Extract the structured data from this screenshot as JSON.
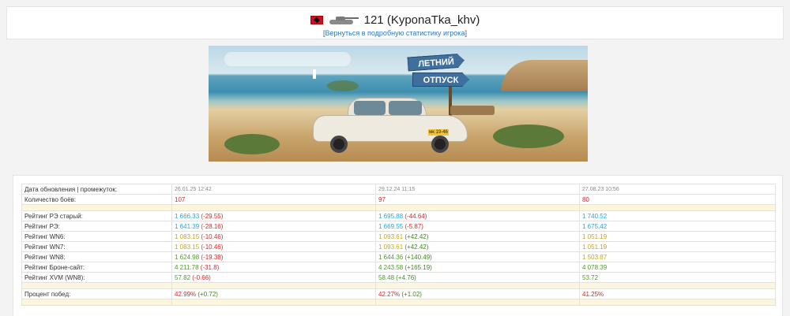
{
  "header": {
    "title": "121 (KyponaTka_khv)",
    "back_link": "Вернуться в подробную статистику игрока",
    "bracket_open": "[",
    "bracket_close": "]"
  },
  "banner": {
    "sign_line1": "ЛЕТНИЙ",
    "sign_line2": "ОТПУСК",
    "plate": "мк 19-46"
  },
  "table": {
    "header_label": "Дата обновления | промежуток:",
    "dates": [
      "26.01.25 12:42",
      "29.12.24 11:15",
      "27.08.23 10:56"
    ],
    "battles": {
      "label": "Количество боёв:",
      "values": [
        "107",
        "97",
        "80"
      ]
    },
    "rows": [
      {
        "label": "Рейтинг РЭ старый:",
        "color": "blue",
        "values": [
          {
            "v": "1 666.33",
            "d": "(-29.55)",
            "dc": "neg"
          },
          {
            "v": "1 695.88",
            "d": "(-44.64)",
            "dc": "neg"
          },
          {
            "v": "1 740.52",
            "d": "",
            "dc": ""
          }
        ]
      },
      {
        "label": "Рейтинг РЭ:",
        "color": "blue",
        "values": [
          {
            "v": "1 641.39",
            "d": "(-28.16)",
            "dc": "neg"
          },
          {
            "v": "1 669.55",
            "d": "(-5.87)",
            "dc": "neg"
          },
          {
            "v": "1 675.42",
            "d": "",
            "dc": ""
          }
        ]
      },
      {
        "label": "Рейтинг WN6:",
        "color": "yellow",
        "values": [
          {
            "v": "1 083.15",
            "d": "(-10.46)",
            "dc": "neg"
          },
          {
            "v": "1 093.61",
            "d": "(+42.42)",
            "dc": "pos"
          },
          {
            "v": "1 051.19",
            "d": "",
            "dc": ""
          }
        ]
      },
      {
        "label": "Рейтинг WN7:",
        "color": "yellow",
        "values": [
          {
            "v": "1 083.15",
            "d": "(-10.46)",
            "dc": "neg"
          },
          {
            "v": "1 093.61",
            "d": "(+42.42)",
            "dc": "pos"
          },
          {
            "v": "1 051.19",
            "d": "",
            "dc": ""
          }
        ]
      },
      {
        "label": "Рейтинг WN8:",
        "color": "green",
        "values": [
          {
            "v": "1 624.98",
            "d": "(-19.38)",
            "dc": "neg"
          },
          {
            "v": "1 644.36",
            "d": "(+140.49)",
            "dc": "pos"
          },
          {
            "v": "1 503.87",
            "d": "",
            "dc": "",
            "color": "yellow"
          }
        ]
      },
      {
        "label": "Рейтинг Броне-сайт:",
        "color": "green",
        "values": [
          {
            "v": "4 211.78",
            "d": "(-31.8)",
            "dc": "neg"
          },
          {
            "v": "4 243.58",
            "d": "(+165.19)",
            "dc": "pos"
          },
          {
            "v": "4 078.39",
            "d": "",
            "dc": ""
          }
        ]
      },
      {
        "label": "Рейтинг XVM (WN8):",
        "color": "green",
        "values": [
          {
            "v": "57.82",
            "d": "(-0.66)",
            "dc": "neg"
          },
          {
            "v": "58.48",
            "d": "(+4.76)",
            "dc": "pos"
          },
          {
            "v": "53.72",
            "d": "",
            "dc": ""
          }
        ]
      }
    ],
    "winrate": {
      "label": "Процент побед:",
      "color": "red",
      "values": [
        {
          "v": "42.99%",
          "d": "(+0.72)",
          "dc": "pos"
        },
        {
          "v": "42.27%",
          "d": "(+1.02)",
          "dc": "pos"
        },
        {
          "v": "41.25%",
          "d": "",
          "dc": ""
        }
      ]
    }
  },
  "colors": {
    "accent_link": "#2a78c0",
    "rating_blue": "#2fa3d6",
    "rating_yellow": "#c9a51a",
    "rating_green": "#4d9a28",
    "red": "#d42a2a",
    "spacer": "#fcf6de"
  },
  "icons": [
    "flag-icon",
    "tank-icon"
  ]
}
